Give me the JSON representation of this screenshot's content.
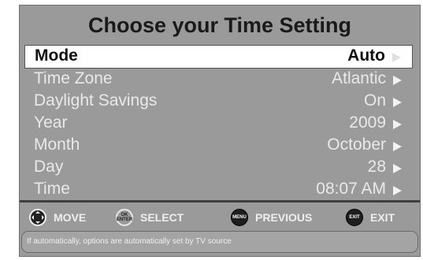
{
  "title": "Choose your Time Setting",
  "rows": [
    {
      "label": "Mode",
      "value": "Auto",
      "selected": true
    },
    {
      "label": "Time Zone",
      "value": "Atlantic"
    },
    {
      "label": "Daylight Savings",
      "value": "On"
    },
    {
      "label": "Year",
      "value": "2009"
    },
    {
      "label": "Month",
      "value": "October"
    },
    {
      "label": "Day",
      "value": "28"
    },
    {
      "label": "Time",
      "value": "08:07 AM"
    }
  ],
  "nav": {
    "move": "MOVE",
    "select": "SELECT",
    "select_icon": "OK ENTER",
    "previous": "PREVIOUS",
    "previous_icon": "MENU",
    "exit": "EXIT",
    "exit_icon": "EXIT"
  },
  "hint": "If automatically, options are automatically set by TV source",
  "colors": {
    "panel": "#9a9a9a",
    "selected_row": "#ffffff",
    "text": "#e9e9e9"
  }
}
